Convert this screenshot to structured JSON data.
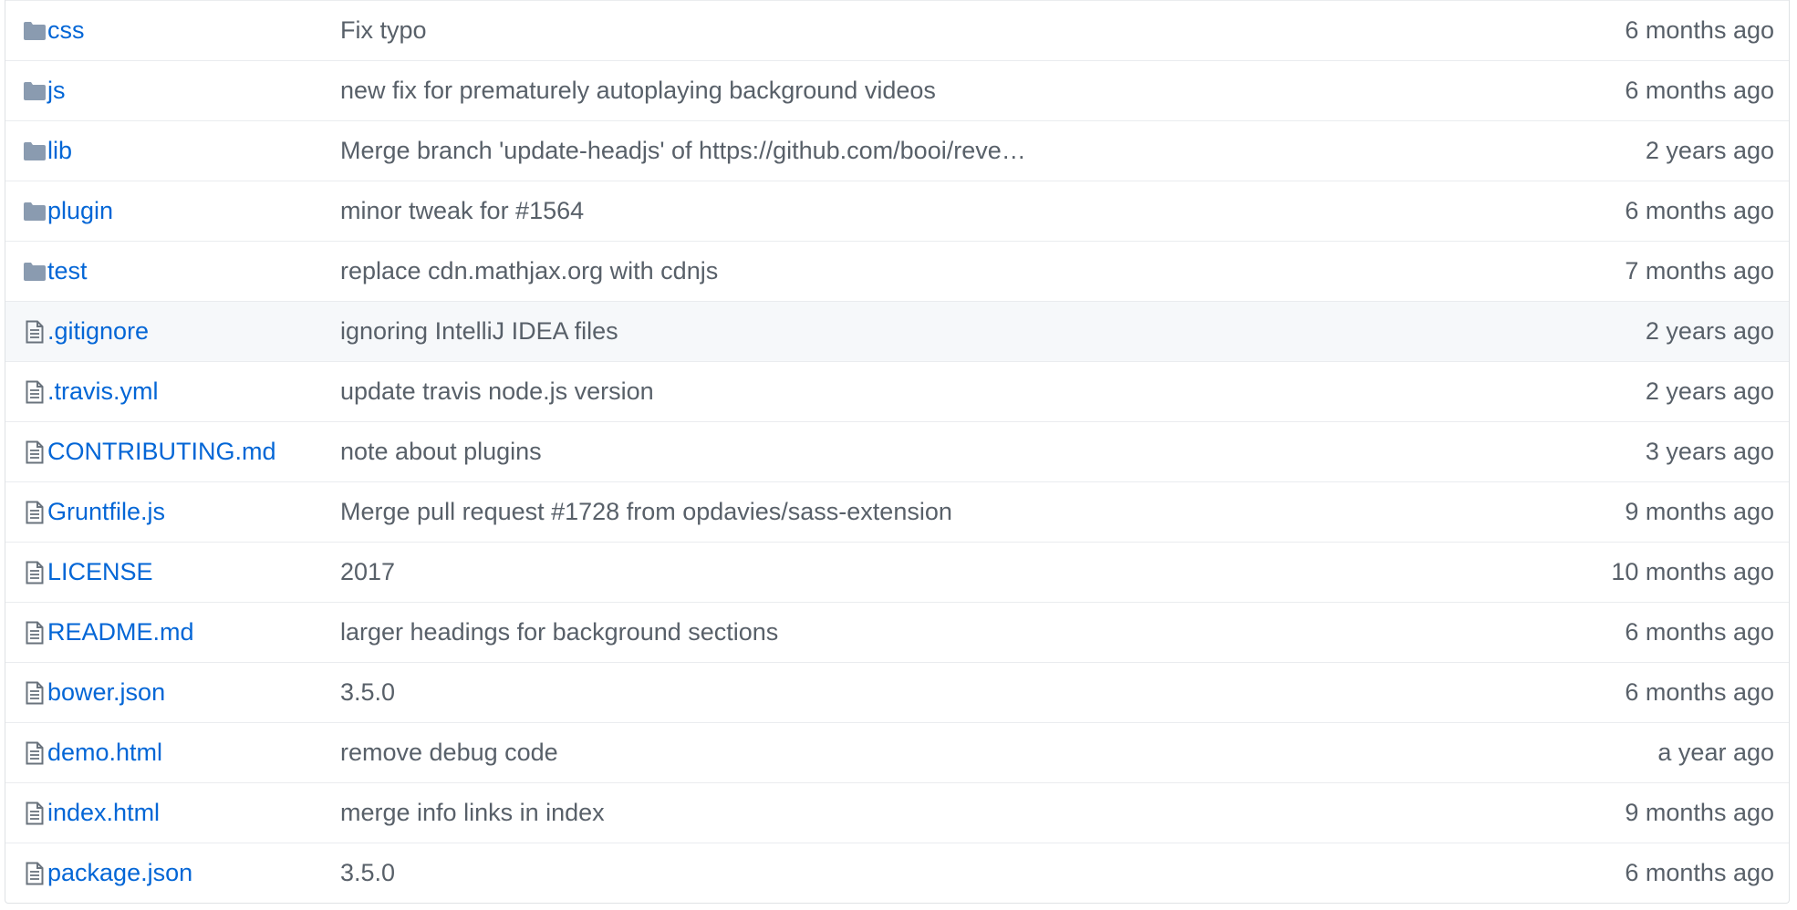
{
  "colors": {
    "link": "#0366d6",
    "muted": "#586069",
    "folder_icon": "#79b8ff",
    "file_icon": "#6a737d",
    "border": "#eaecef",
    "hover_bg": "#f6f8fa"
  },
  "files": [
    {
      "type": "folder",
      "icon": "folder-icon",
      "name": "css",
      "message": "Fix typo",
      "age": "6 months ago"
    },
    {
      "type": "folder",
      "icon": "folder-icon",
      "name": "js",
      "message": "new fix for prematurely autoplaying background videos",
      "age": "6 months ago"
    },
    {
      "type": "folder",
      "icon": "folder-icon",
      "name": "lib",
      "message": "Merge branch 'update-headjs' of https://github.com/booi/reveal.js int…",
      "age": "2 years ago"
    },
    {
      "type": "folder",
      "icon": "folder-icon",
      "name": "plugin",
      "message": "minor tweak for #1564",
      "age": "6 months ago"
    },
    {
      "type": "folder",
      "icon": "folder-icon",
      "name": "test",
      "message": "replace cdn.mathjax.org with cdnjs",
      "age": "7 months ago"
    },
    {
      "type": "file",
      "icon": "file-icon",
      "name": ".gitignore",
      "message": "ignoring IntelliJ IDEA files",
      "age": "2 years ago"
    },
    {
      "type": "file",
      "icon": "file-icon",
      "name": ".travis.yml",
      "message": "update travis node.js version",
      "age": "2 years ago"
    },
    {
      "type": "file",
      "icon": "file-icon",
      "name": "CONTRIBUTING.md",
      "message": "note about plugins",
      "age": "3 years ago"
    },
    {
      "type": "file",
      "icon": "file-icon",
      "name": "Gruntfile.js",
      "message": "Merge pull request #1728 from opdavies/sass-extension",
      "age": "9 months ago"
    },
    {
      "type": "file",
      "icon": "file-icon",
      "name": "LICENSE",
      "message": "2017",
      "age": "10 months ago"
    },
    {
      "type": "file",
      "icon": "file-icon",
      "name": "README.md",
      "message": "larger headings for background sections",
      "age": "6 months ago"
    },
    {
      "type": "file",
      "icon": "file-icon",
      "name": "bower.json",
      "message": "3.5.0",
      "age": "6 months ago"
    },
    {
      "type": "file",
      "icon": "file-icon",
      "name": "demo.html",
      "message": "remove debug code",
      "age": "a year ago"
    },
    {
      "type": "file",
      "icon": "file-icon",
      "name": "index.html",
      "message": "merge info links in index",
      "age": "9 months ago"
    },
    {
      "type": "file",
      "icon": "file-icon",
      "name": "package.json",
      "message": "3.5.0",
      "age": "6 months ago"
    }
  ]
}
